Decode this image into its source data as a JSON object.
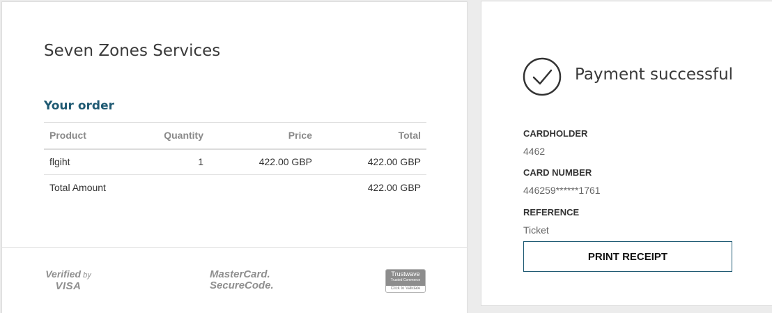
{
  "merchant": {
    "name": "Seven Zones Services"
  },
  "order": {
    "heading": "Your order",
    "columns": [
      "Product",
      "Quantity",
      "Price",
      "Total"
    ],
    "rows": [
      {
        "product": "flgiht",
        "quantity": "1",
        "price": "422.00 GBP",
        "total": "422.00 GBP"
      }
    ],
    "total_label": "Total Amount",
    "total_value": "422.00 GBP"
  },
  "logos": {
    "visa_top": "Verified",
    "visa_by": "by",
    "visa_bottom": "VISA",
    "mastercard_line1": "MasterCard.",
    "mastercard_line2": "SecureCode.",
    "trustwave_name": "Trustwave",
    "trustwave_sub": "Trusted Commerce",
    "trustwave_foot": "Click to Validate"
  },
  "status": {
    "title": "Payment successful",
    "icon": "check-circle-icon"
  },
  "details": {
    "cardholder_label": "CARDHOLDER",
    "cardholder_value": "4462",
    "card_number_label": "CARD NUMBER",
    "card_number_value": "446259******1761",
    "reference_label": "REFERENCE",
    "reference_value": "Ticket"
  },
  "actions": {
    "print_label": "PRINT RECEIPT"
  },
  "colors": {
    "accent": "#1f5a73",
    "background": "#ececec"
  }
}
